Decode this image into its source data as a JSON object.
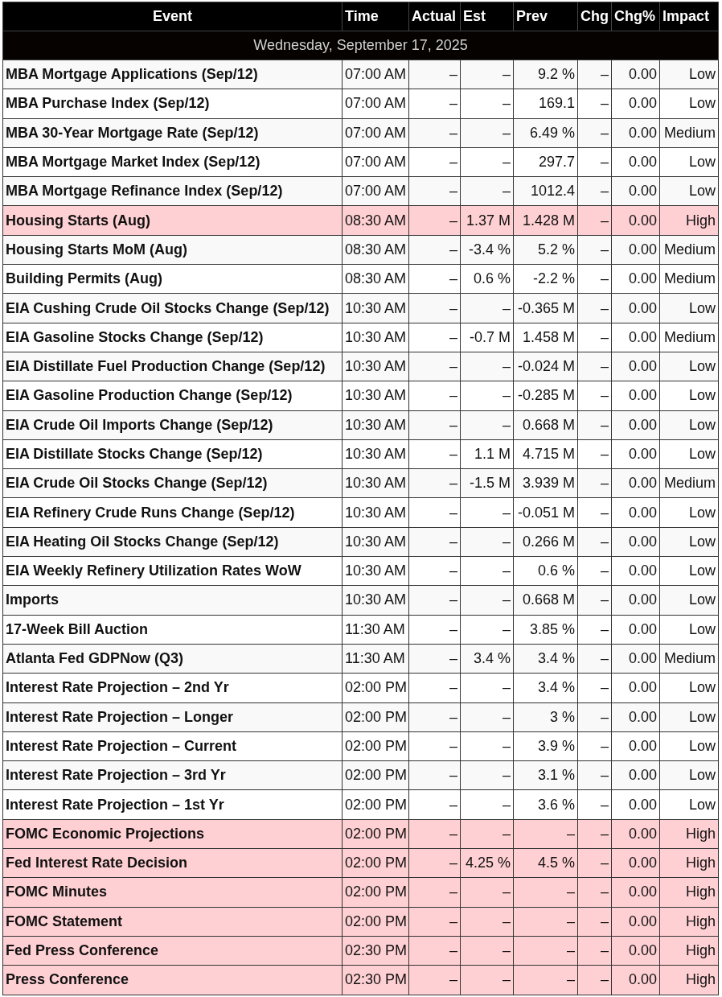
{
  "columns": [
    "Event",
    "Time",
    "Actual",
    "Est",
    "Prev",
    "Chg",
    "Chg%",
    "Impact"
  ],
  "date": "Wednesday, September 17, 2025",
  "rows": [
    {
      "event": "MBA Mortgage Applications (Sep/12)",
      "time": "07:00 AM",
      "actual": "–",
      "est": "–",
      "prev": "9.2 %",
      "chg": "–",
      "chg_pct": "0.00",
      "impact": "Low",
      "highlighted": false
    },
    {
      "event": "MBA Purchase Index (Sep/12)",
      "time": "07:00 AM",
      "actual": "–",
      "est": "–",
      "prev": "169.1",
      "chg": "–",
      "chg_pct": "0.00",
      "impact": "Low",
      "highlighted": false
    },
    {
      "event": "MBA 30-Year Mortgage Rate (Sep/12)",
      "time": "07:00 AM",
      "actual": "–",
      "est": "–",
      "prev": "6.49 %",
      "chg": "–",
      "chg_pct": "0.00",
      "impact": "Medium",
      "highlighted": false
    },
    {
      "event": "MBA Mortgage Market Index (Sep/12)",
      "time": "07:00 AM",
      "actual": "–",
      "est": "–",
      "prev": "297.7",
      "chg": "–",
      "chg_pct": "0.00",
      "impact": "Low",
      "highlighted": false
    },
    {
      "event": "MBA Mortgage Refinance Index (Sep/12)",
      "time": "07:00 AM",
      "actual": "–",
      "est": "–",
      "prev": "1012.4",
      "chg": "–",
      "chg_pct": "0.00",
      "impact": "Low",
      "highlighted": false
    },
    {
      "event": "Housing Starts (Aug)",
      "time": "08:30 AM",
      "actual": "–",
      "est": "1.37 M",
      "prev": "1.428 M",
      "chg": "–",
      "chg_pct": "0.00",
      "impact": "High",
      "highlighted": true
    },
    {
      "event": "Housing Starts MoM (Aug)",
      "time": "08:30 AM",
      "actual": "–",
      "est": "-3.4 %",
      "prev": "5.2 %",
      "chg": "–",
      "chg_pct": "0.00",
      "impact": "Medium",
      "highlighted": false
    },
    {
      "event": "Building Permits (Aug)",
      "time": "08:30 AM",
      "actual": "–",
      "est": "0.6 %",
      "prev": "-2.2 %",
      "chg": "–",
      "chg_pct": "0.00",
      "impact": "Medium",
      "highlighted": false
    },
    {
      "event": "EIA Cushing Crude Oil Stocks Change (Sep/12)",
      "time": "10:30 AM",
      "actual": "–",
      "est": "–",
      "prev": "-0.365 M",
      "chg": "–",
      "chg_pct": "0.00",
      "impact": "Low",
      "highlighted": false
    },
    {
      "event": "EIA Gasoline Stocks Change (Sep/12)",
      "time": "10:30 AM",
      "actual": "–",
      "est": "-0.7 M",
      "prev": "1.458 M",
      "chg": "–",
      "chg_pct": "0.00",
      "impact": "Medium",
      "highlighted": false
    },
    {
      "event": "EIA Distillate Fuel Production Change (Sep/12)",
      "time": "10:30 AM",
      "actual": "–",
      "est": "–",
      "prev": "-0.024 M",
      "chg": "–",
      "chg_pct": "0.00",
      "impact": "Low",
      "highlighted": false
    },
    {
      "event": "EIA Gasoline Production Change (Sep/12)",
      "time": "10:30 AM",
      "actual": "–",
      "est": "–",
      "prev": "-0.285 M",
      "chg": "–",
      "chg_pct": "0.00",
      "impact": "Low",
      "highlighted": false
    },
    {
      "event": "EIA Crude Oil Imports Change (Sep/12)",
      "time": "10:30 AM",
      "actual": "–",
      "est": "–",
      "prev": "0.668 M",
      "chg": "–",
      "chg_pct": "0.00",
      "impact": "Low",
      "highlighted": false
    },
    {
      "event": "EIA Distillate Stocks Change (Sep/12)",
      "time": "10:30 AM",
      "actual": "–",
      "est": "1.1 M",
      "prev": "4.715 M",
      "chg": "–",
      "chg_pct": "0.00",
      "impact": "Low",
      "highlighted": false
    },
    {
      "event": "EIA Crude Oil Stocks Change (Sep/12)",
      "time": "10:30 AM",
      "actual": "–",
      "est": "-1.5 M",
      "prev": "3.939 M",
      "chg": "–",
      "chg_pct": "0.00",
      "impact": "Medium",
      "highlighted": false
    },
    {
      "event": "EIA Refinery Crude Runs Change (Sep/12)",
      "time": "10:30 AM",
      "actual": "–",
      "est": "–",
      "prev": "-0.051 M",
      "chg": "–",
      "chg_pct": "0.00",
      "impact": "Low",
      "highlighted": false
    },
    {
      "event": "EIA Heating Oil Stocks Change (Sep/12)",
      "time": "10:30 AM",
      "actual": "–",
      "est": "–",
      "prev": "0.266 M",
      "chg": "–",
      "chg_pct": "0.00",
      "impact": "Low",
      "highlighted": false
    },
    {
      "event": "EIA Weekly Refinery Utilization Rates WoW",
      "time": "10:30 AM",
      "actual": "–",
      "est": "–",
      "prev": "0.6 %",
      "chg": "–",
      "chg_pct": "0.00",
      "impact": "Low",
      "highlighted": false
    },
    {
      "event": "Imports",
      "time": "10:30 AM",
      "actual": "–",
      "est": "–",
      "prev": "0.668 M",
      "chg": "–",
      "chg_pct": "0.00",
      "impact": "Low",
      "highlighted": false
    },
    {
      "event": "17-Week Bill Auction",
      "time": "11:30 AM",
      "actual": "–",
      "est": "–",
      "prev": "3.85 %",
      "chg": "–",
      "chg_pct": "0.00",
      "impact": "Low",
      "highlighted": false
    },
    {
      "event": "Atlanta Fed GDPNow (Q3)",
      "time": "11:30 AM",
      "actual": "–",
      "est": "3.4 %",
      "prev": "3.4 %",
      "chg": "–",
      "chg_pct": "0.00",
      "impact": "Medium",
      "highlighted": false
    },
    {
      "event": "Interest Rate Projection – 2nd Yr",
      "time": "02:00 PM",
      "actual": "–",
      "est": "–",
      "prev": "3.4 %",
      "chg": "–",
      "chg_pct": "0.00",
      "impact": "Low",
      "highlighted": false
    },
    {
      "event": "Interest Rate Projection – Longer",
      "time": "02:00 PM",
      "actual": "–",
      "est": "–",
      "prev": "3 %",
      "chg": "–",
      "chg_pct": "0.00",
      "impact": "Low",
      "highlighted": false
    },
    {
      "event": "Interest Rate Projection – Current",
      "time": "02:00 PM",
      "actual": "–",
      "est": "–",
      "prev": "3.9 %",
      "chg": "–",
      "chg_pct": "0.00",
      "impact": "Low",
      "highlighted": false
    },
    {
      "event": "Interest Rate Projection – 3rd Yr",
      "time": "02:00 PM",
      "actual": "–",
      "est": "–",
      "prev": "3.1 %",
      "chg": "–",
      "chg_pct": "0.00",
      "impact": "Low",
      "highlighted": false
    },
    {
      "event": "Interest Rate Projection – 1st Yr",
      "time": "02:00 PM",
      "actual": "–",
      "est": "–",
      "prev": "3.6 %",
      "chg": "–",
      "chg_pct": "0.00",
      "impact": "Low",
      "highlighted": false
    },
    {
      "event": "FOMC Economic Projections",
      "time": "02:00 PM",
      "actual": "–",
      "est": "–",
      "prev": "–",
      "chg": "–",
      "chg_pct": "0.00",
      "impact": "High",
      "highlighted": true
    },
    {
      "event": "Fed Interest Rate Decision",
      "time": "02:00 PM",
      "actual": "–",
      "est": "4.25 %",
      "prev": "4.5 %",
      "chg": "–",
      "chg_pct": "0.00",
      "impact": "High",
      "highlighted": true
    },
    {
      "event": "FOMC Minutes",
      "time": "02:00 PM",
      "actual": "–",
      "est": "–",
      "prev": "–",
      "chg": "–",
      "chg_pct": "0.00",
      "impact": "High",
      "highlighted": true
    },
    {
      "event": "FOMC Statement",
      "time": "02:00 PM",
      "actual": "–",
      "est": "–",
      "prev": "–",
      "chg": "–",
      "chg_pct": "0.00",
      "impact": "High",
      "highlighted": true
    },
    {
      "event": "Fed Press Conference",
      "time": "02:30 PM",
      "actual": "–",
      "est": "–",
      "prev": "–",
      "chg": "–",
      "chg_pct": "0.00",
      "impact": "High",
      "highlighted": true
    },
    {
      "event": "Press Conference",
      "time": "02:30 PM",
      "actual": "–",
      "est": "–",
      "prev": "–",
      "chg": "–",
      "chg_pct": "0.00",
      "impact": "High",
      "highlighted": true
    }
  ]
}
